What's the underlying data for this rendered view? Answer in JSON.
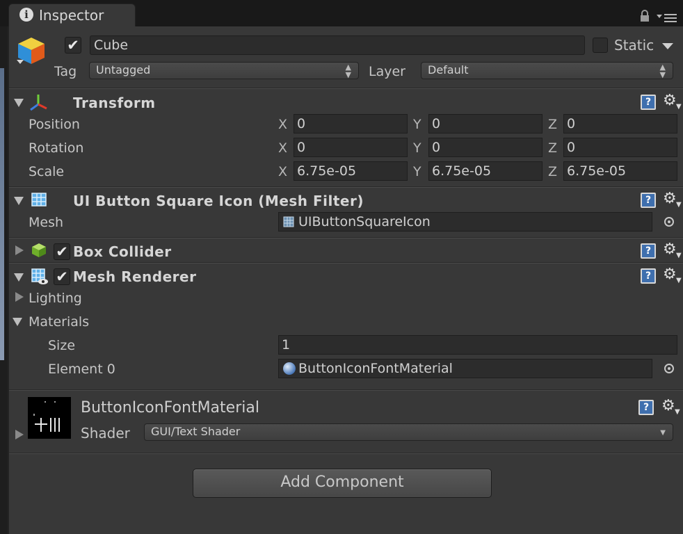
{
  "tab": {
    "title": "Inspector"
  },
  "header": {
    "object_active": true,
    "object_name": "Cube",
    "static_label": "Static",
    "static_checked": false,
    "tag_label": "Tag",
    "tag_value": "Untagged",
    "layer_label": "Layer",
    "layer_value": "Default"
  },
  "transform": {
    "title": "Transform",
    "rows": [
      {
        "label": "Position",
        "x": "0",
        "y": "0",
        "z": "0"
      },
      {
        "label": "Rotation",
        "x": "0",
        "y": "0",
        "z": "0"
      },
      {
        "label": "Scale",
        "x": "6.75e-05",
        "y": "6.75e-05",
        "z": "6.75e-05"
      }
    ],
    "axis_x": "X",
    "axis_y": "Y",
    "axis_z": "Z"
  },
  "mesh_filter": {
    "title": "UI Button Square Icon (Mesh Filter)",
    "mesh_label": "Mesh",
    "mesh_value": "UIButtonSquareIcon"
  },
  "box_collider": {
    "title": "Box Collider",
    "enabled": true
  },
  "mesh_renderer": {
    "title": "Mesh Renderer",
    "enabled": true,
    "lighting_label": "Lighting",
    "materials_label": "Materials",
    "size_label": "Size",
    "size_value": "1",
    "element_label": "Element 0",
    "element_value": "ButtonIconFontMaterial"
  },
  "material": {
    "name": "ButtonIconFontMaterial",
    "shader_label": "Shader",
    "shader_value": "GUI/Text Shader"
  },
  "add_component_label": "Add Component",
  "colors": {
    "panel": "#383838",
    "field": "#2c2c2c",
    "help_blue": "#3f6fae",
    "tab_bar": "#191919"
  }
}
